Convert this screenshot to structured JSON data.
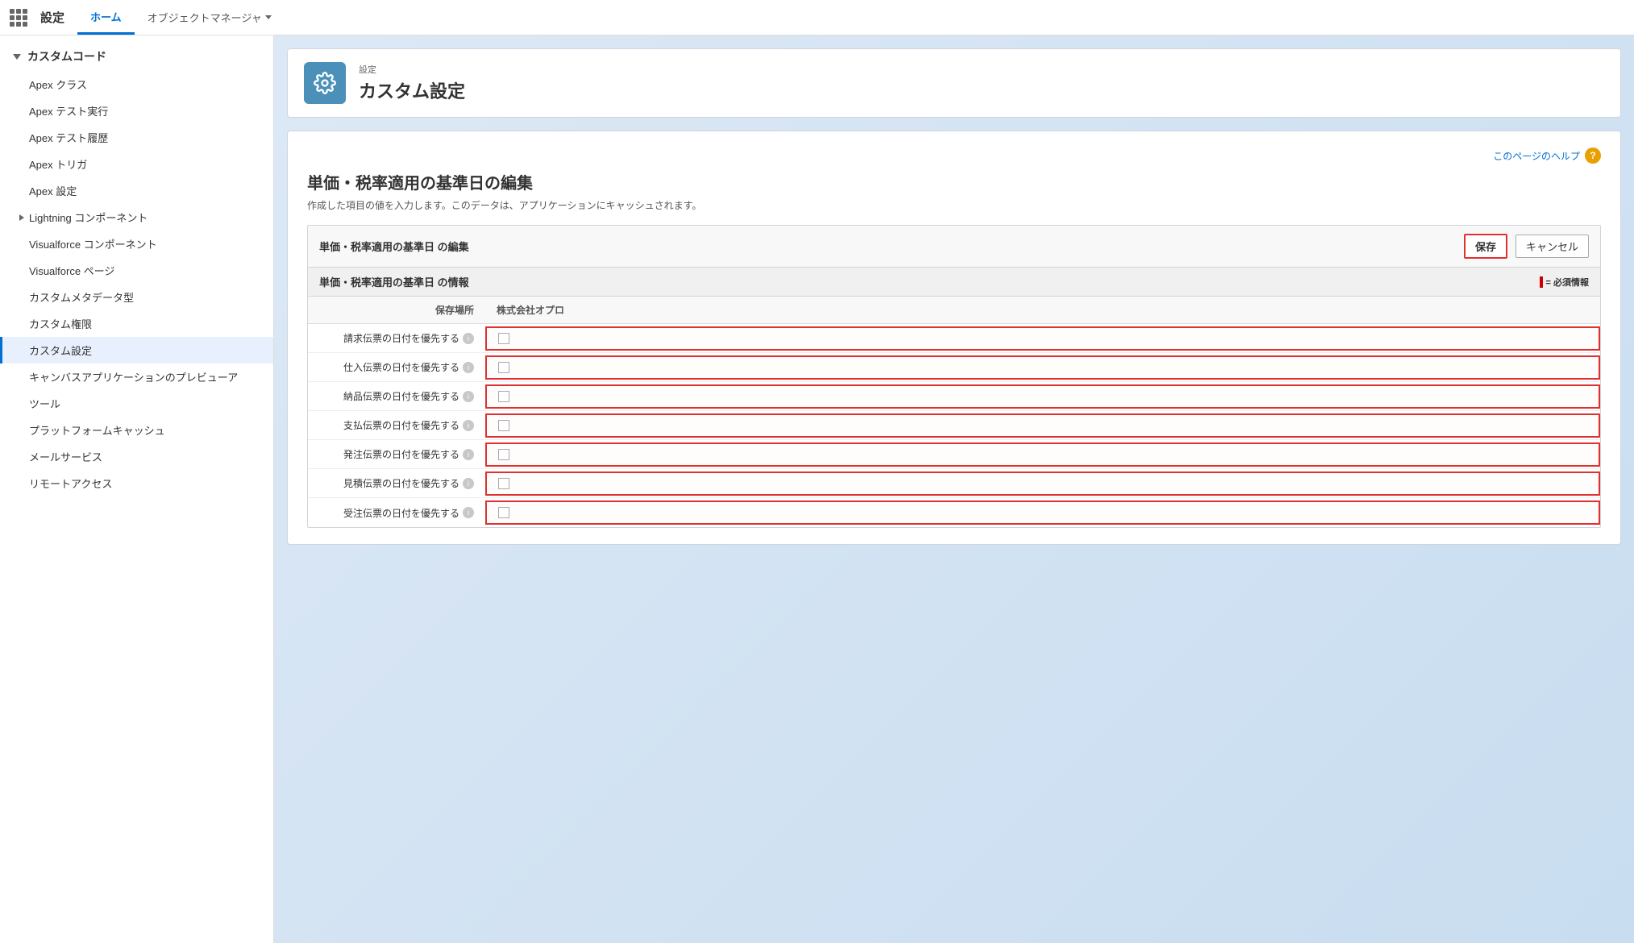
{
  "topbar": {
    "title": "設定",
    "tabs": [
      {
        "label": "ホーム",
        "active": true
      },
      {
        "label": "オブジェクトマネージャ",
        "hasDropdown": true
      }
    ]
  },
  "sidebar": {
    "sections": [
      {
        "label": "カスタムコード",
        "open": true,
        "items": [
          {
            "label": "Apex クラス",
            "active": false
          },
          {
            "label": "Apex テスト実行",
            "active": false
          },
          {
            "label": "Apex テスト履歴",
            "active": false
          },
          {
            "label": "Apex トリガ",
            "active": false
          },
          {
            "label": "Apex 設定",
            "active": false
          },
          {
            "label": "Lightning コンポーネント",
            "hasSubsection": true,
            "active": false
          },
          {
            "label": "Visualforce コンポーネント",
            "active": false
          },
          {
            "label": "Visualforce ページ",
            "active": false
          },
          {
            "label": "カスタムメタデータ型",
            "active": false
          },
          {
            "label": "カスタム権限",
            "active": false
          },
          {
            "label": "カスタム設定",
            "active": true
          },
          {
            "label": "キャンバスアプリケーションのプレビューア",
            "active": false
          },
          {
            "label": "ツール",
            "active": false
          },
          {
            "label": "プラットフォームキャッシュ",
            "active": false
          },
          {
            "label": "メールサービス",
            "active": false
          },
          {
            "label": "リモートアクセス",
            "active": false
          }
        ]
      }
    ]
  },
  "page": {
    "header": {
      "subtitle": "設定",
      "title": "カスタム設定"
    },
    "help_link": "このページのヘルプ",
    "form_title": "単価・税率適用の基準日の編集",
    "form_desc": "作成した項目の値を入力します。このデータは、アプリケーションにキャッシュされます。",
    "section_edit_title": "単価・税率適用の基準日 の編集",
    "btn_save": "保存",
    "btn_cancel": "キャンセル",
    "section_info_title": "単価・税率適用の基準日 の情報",
    "required_label": "= 必須情報",
    "col_storage": "保存場所",
    "col_company": "株式会社オプロ",
    "rows": [
      {
        "label": "請求伝票の日付を優先する",
        "checked": false
      },
      {
        "label": "仕入伝票の日付を優先する",
        "checked": false
      },
      {
        "label": "納品伝票の日付を優先する",
        "checked": false
      },
      {
        "label": "支払伝票の日付を優先する",
        "checked": false
      },
      {
        "label": "発注伝票の日付を優先する",
        "checked": false
      },
      {
        "label": "見積伝票の日付を優先する",
        "checked": false
      },
      {
        "label": "受注伝票の日付を優先する",
        "checked": false
      }
    ]
  }
}
